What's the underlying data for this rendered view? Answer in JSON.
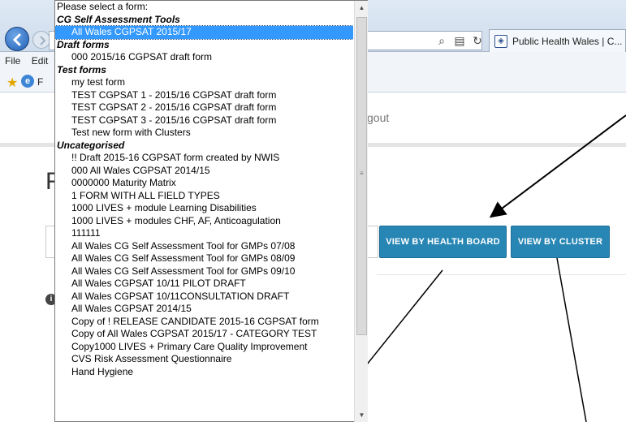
{
  "browser": {
    "menu": [
      "File",
      "Edit"
    ],
    "favorites_text": "F",
    "tab_title": "Public Health Wales | C..."
  },
  "page": {
    "logout_fragment": "gout",
    "heading_fragment": "F",
    "view_by_health_board": "VIEW BY HEALTH BOARD",
    "view_by_cluster": "VIEW BY CLUSTER",
    "info_icon": "i"
  },
  "dropdown": {
    "prompt": "Please select a form:",
    "groups": [
      {
        "label": "CG Self Assessment Tools",
        "items": [
          "All Wales CGPSAT 2015/17"
        ]
      },
      {
        "label": "Draft forms",
        "items": [
          "000 2015/16 CGPSAT draft form"
        ]
      },
      {
        "label": "Test forms",
        "items": [
          "my test form",
          "TEST CGPSAT 1 - 2015/16 CGPSAT draft form",
          "TEST CGPSAT 2 - 2015/16 CGPSAT draft form",
          "TEST CGPSAT 3 - 2015/16 CGPSAT draft form",
          "Test new form with Clusters"
        ]
      },
      {
        "label": "Uncategorised",
        "items": [
          "!! Draft 2015-16 CGPSAT form created by NWIS",
          "000 All Wales CGPSAT 2014/15",
          "0000000 Maturity Matrix",
          "1 FORM WITH ALL FIELD TYPES",
          "1000 LIVES + module Learning Disabilities",
          "1000 LIVES + modules CHF, AF, Anticoagulation",
          "111111",
          "All Wales CG Self Assessment Tool for GMPs 07/08",
          "All Wales CG Self Assessment Tool for GMPs 08/09",
          "All Wales CG Self Assessment Tool for GMPs 09/10",
          "All Wales CGPSAT 10/11 PILOT DRAFT",
          "All Wales CGPSAT 10/11CONSULTATION DRAFT",
          "All Wales CGPSAT 2014/15",
          "Copy of ! RELEASE CANDIDATE 2015-16 CGPSAT form",
          "Copy of All Wales CGPSAT 2015/17 - CATEGORY TEST",
          "Copy1000 LIVES + Primary Care Quality Improvement",
          "CVS Risk Assessment Questionnaire",
          "Hand Hygiene"
        ]
      }
    ],
    "selected": "All Wales CGPSAT 2015/17"
  },
  "colors": {
    "button": "#2786b4",
    "selected_highlight": "#3399ff"
  }
}
